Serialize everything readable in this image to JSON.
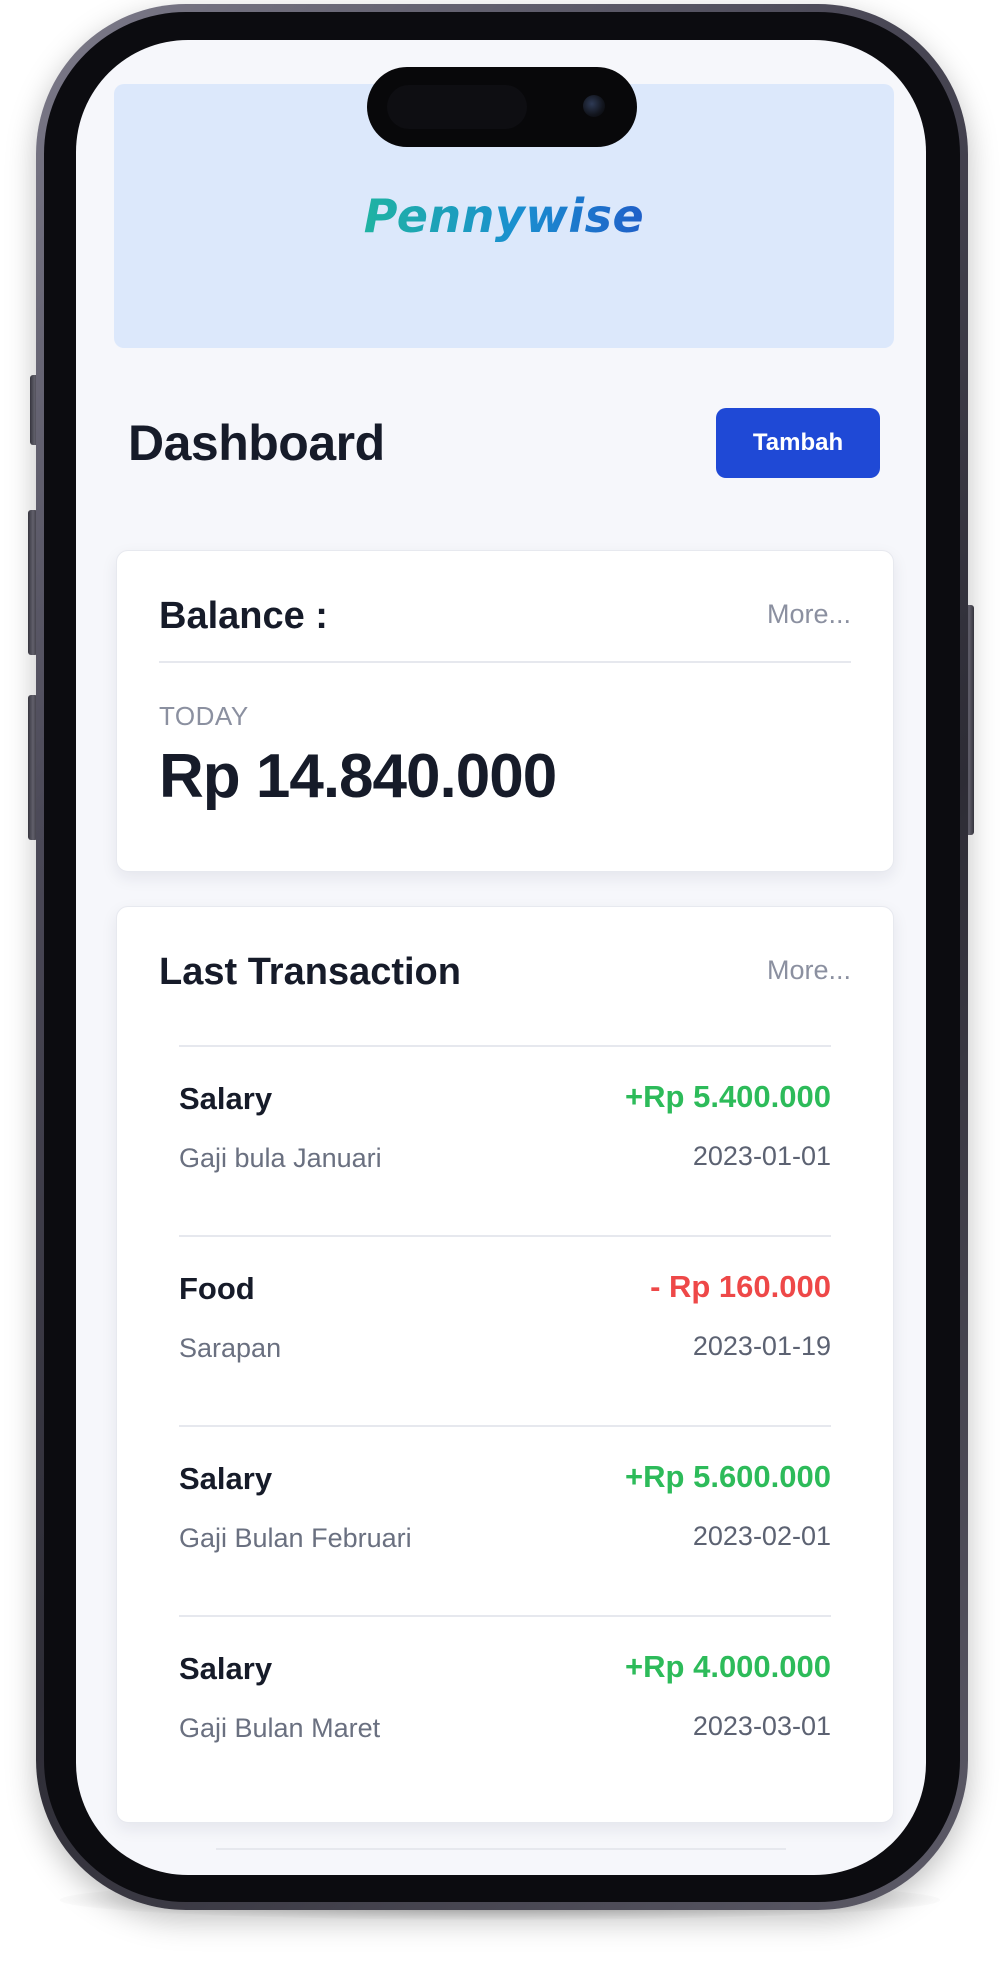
{
  "app": {
    "logo_text": "Pennywise"
  },
  "header": {
    "title": "Dashboard",
    "add_button_label": "Tambah"
  },
  "balance": {
    "title": "Balance :",
    "more_label": "More...",
    "period_label": "TODAY",
    "amount": "Rp 14.840.000"
  },
  "transactions": {
    "title": "Last Transaction",
    "more_label": "More...",
    "items": [
      {
        "name": "Salary",
        "amount": "+Rp 5.400.000",
        "type": "income",
        "description": "Gaji bula Januari",
        "date": "2023-01-01"
      },
      {
        "name": "Food",
        "amount": "- Rp 160.000",
        "type": "expense",
        "description": "Sarapan",
        "date": "2023-01-19"
      },
      {
        "name": "Salary",
        "amount": "+Rp 5.600.000",
        "type": "income",
        "description": "Gaji Bulan Februari",
        "date": "2023-02-01"
      },
      {
        "name": "Salary",
        "amount": "+Rp 4.000.000",
        "type": "income",
        "description": "Gaji Bulan Maret",
        "date": "2023-03-01"
      }
    ]
  },
  "colors": {
    "primary": "#1f49d6",
    "banner": "#dce8fb",
    "income": "#2dbb5a",
    "expense": "#ee4848",
    "text_dark": "#161b29",
    "text_muted": "#8b90a0"
  }
}
